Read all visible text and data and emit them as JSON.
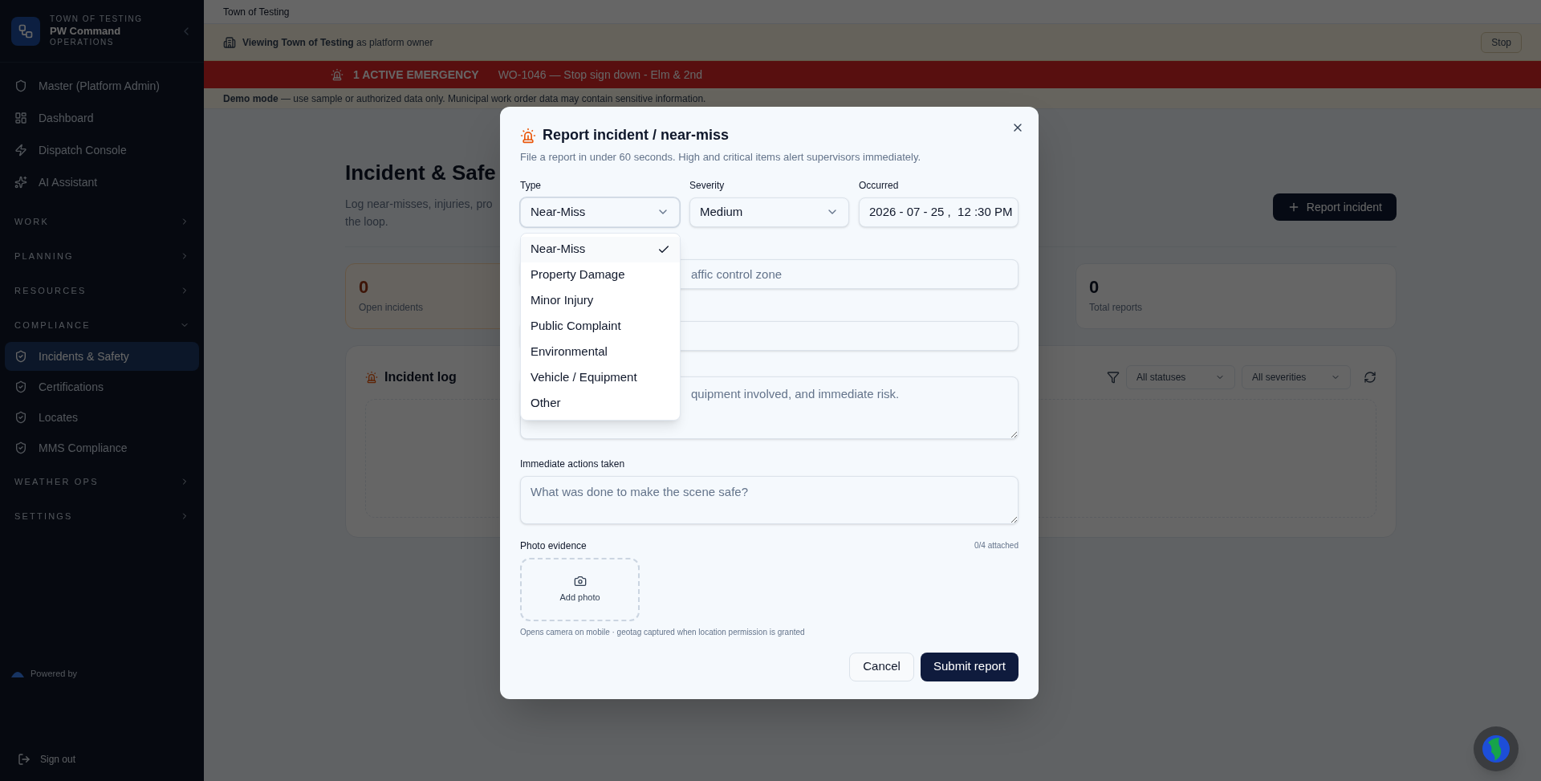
{
  "sidebar": {
    "org": "TOWN OF TESTING",
    "app": "PW Command",
    "sub": "OPERATIONS",
    "top_items": [
      {
        "label": "Master (Platform Admin)",
        "selected": false
      },
      {
        "label": "Dashboard",
        "selected": false
      },
      {
        "label": "Dispatch Console",
        "selected": false
      },
      {
        "label": "AI Assistant",
        "selected": false
      }
    ],
    "sections": [
      {
        "label": "WORK",
        "expanded": false
      },
      {
        "label": "PLANNING",
        "expanded": false
      },
      {
        "label": "RESOURCES",
        "expanded": false
      },
      {
        "label": "COMPLIANCE",
        "expanded": true,
        "children": [
          {
            "label": "Incidents & Safety",
            "selected": true
          },
          {
            "label": "Certifications",
            "selected": false
          },
          {
            "label": "Locates",
            "selected": false
          },
          {
            "label": "MMS Compliance",
            "selected": false
          }
        ]
      },
      {
        "label": "WEATHER OPS",
        "expanded": false
      },
      {
        "label": "SETTINGS",
        "expanded": false
      }
    ],
    "powered_by": "Powered by",
    "sign_out": "Sign out"
  },
  "header": {
    "breadcrumb": "Town of Testing"
  },
  "impersonation": {
    "bold": "Viewing Town of Testing",
    "rest": "as platform owner",
    "button": "Stop"
  },
  "emergency": {
    "title": "1 ACTIVE EMERGENCY",
    "detail": "WO-1046 — Stop sign down - Elm & 2nd"
  },
  "demo_notice": "**Demo mode** — use sample or authorized data only. Municipal work order data may contain sensitive information.",
  "page": {
    "title": "Incident & Safe",
    "subtitle_1": "Log near-misses, injuries, pro",
    "subtitle_2": "the loop.",
    "report_button": "Report incident",
    "stats": [
      {
        "value": "0",
        "label": "Open incidents",
        "kind": "warn"
      },
      {
        "value": "0",
        "label": "Total reports",
        "kind": "plain"
      }
    ],
    "log": {
      "title": "Incident log",
      "status_filter": "All statuses",
      "severity_filter": "All severities"
    }
  },
  "modal": {
    "title": "Report incident / near-miss",
    "subtitle": "File a report in under 60 seconds. High and critical items alert supervisors immediately.",
    "type": {
      "label": "Type",
      "value": "Near-Miss",
      "expanded": true,
      "options": [
        {
          "label": "Near-Miss",
          "selected": true
        },
        {
          "label": "Property Damage",
          "selected": false
        },
        {
          "label": "Minor Injury",
          "selected": false
        },
        {
          "label": "Public Complaint",
          "selected": false
        },
        {
          "label": "Environmental",
          "selected": false
        },
        {
          "label": "Vehicle / Equipment",
          "selected": false
        },
        {
          "label": "Other",
          "selected": false
        }
      ]
    },
    "severity": {
      "label": "Severity",
      "value": "Medium"
    },
    "occurred": {
      "label": "Occurred",
      "value": "2026 - 07 - 25 ,  12 :30 PM"
    },
    "title_field": {
      "placeholder": "affic control zone"
    },
    "description_field": {
      "placeholder": "quipment involved, and immediate risk."
    },
    "actions": {
      "label": "Immediate actions taken",
      "placeholder": "What was done to make the scene safe?"
    },
    "photo": {
      "label": "Photo evidence",
      "count": "0/4 attached",
      "add": "Add photo",
      "hint": "Opens camera on mobile · geotag captured when location permission is granted"
    },
    "cancel": "Cancel",
    "submit": "Submit report"
  }
}
